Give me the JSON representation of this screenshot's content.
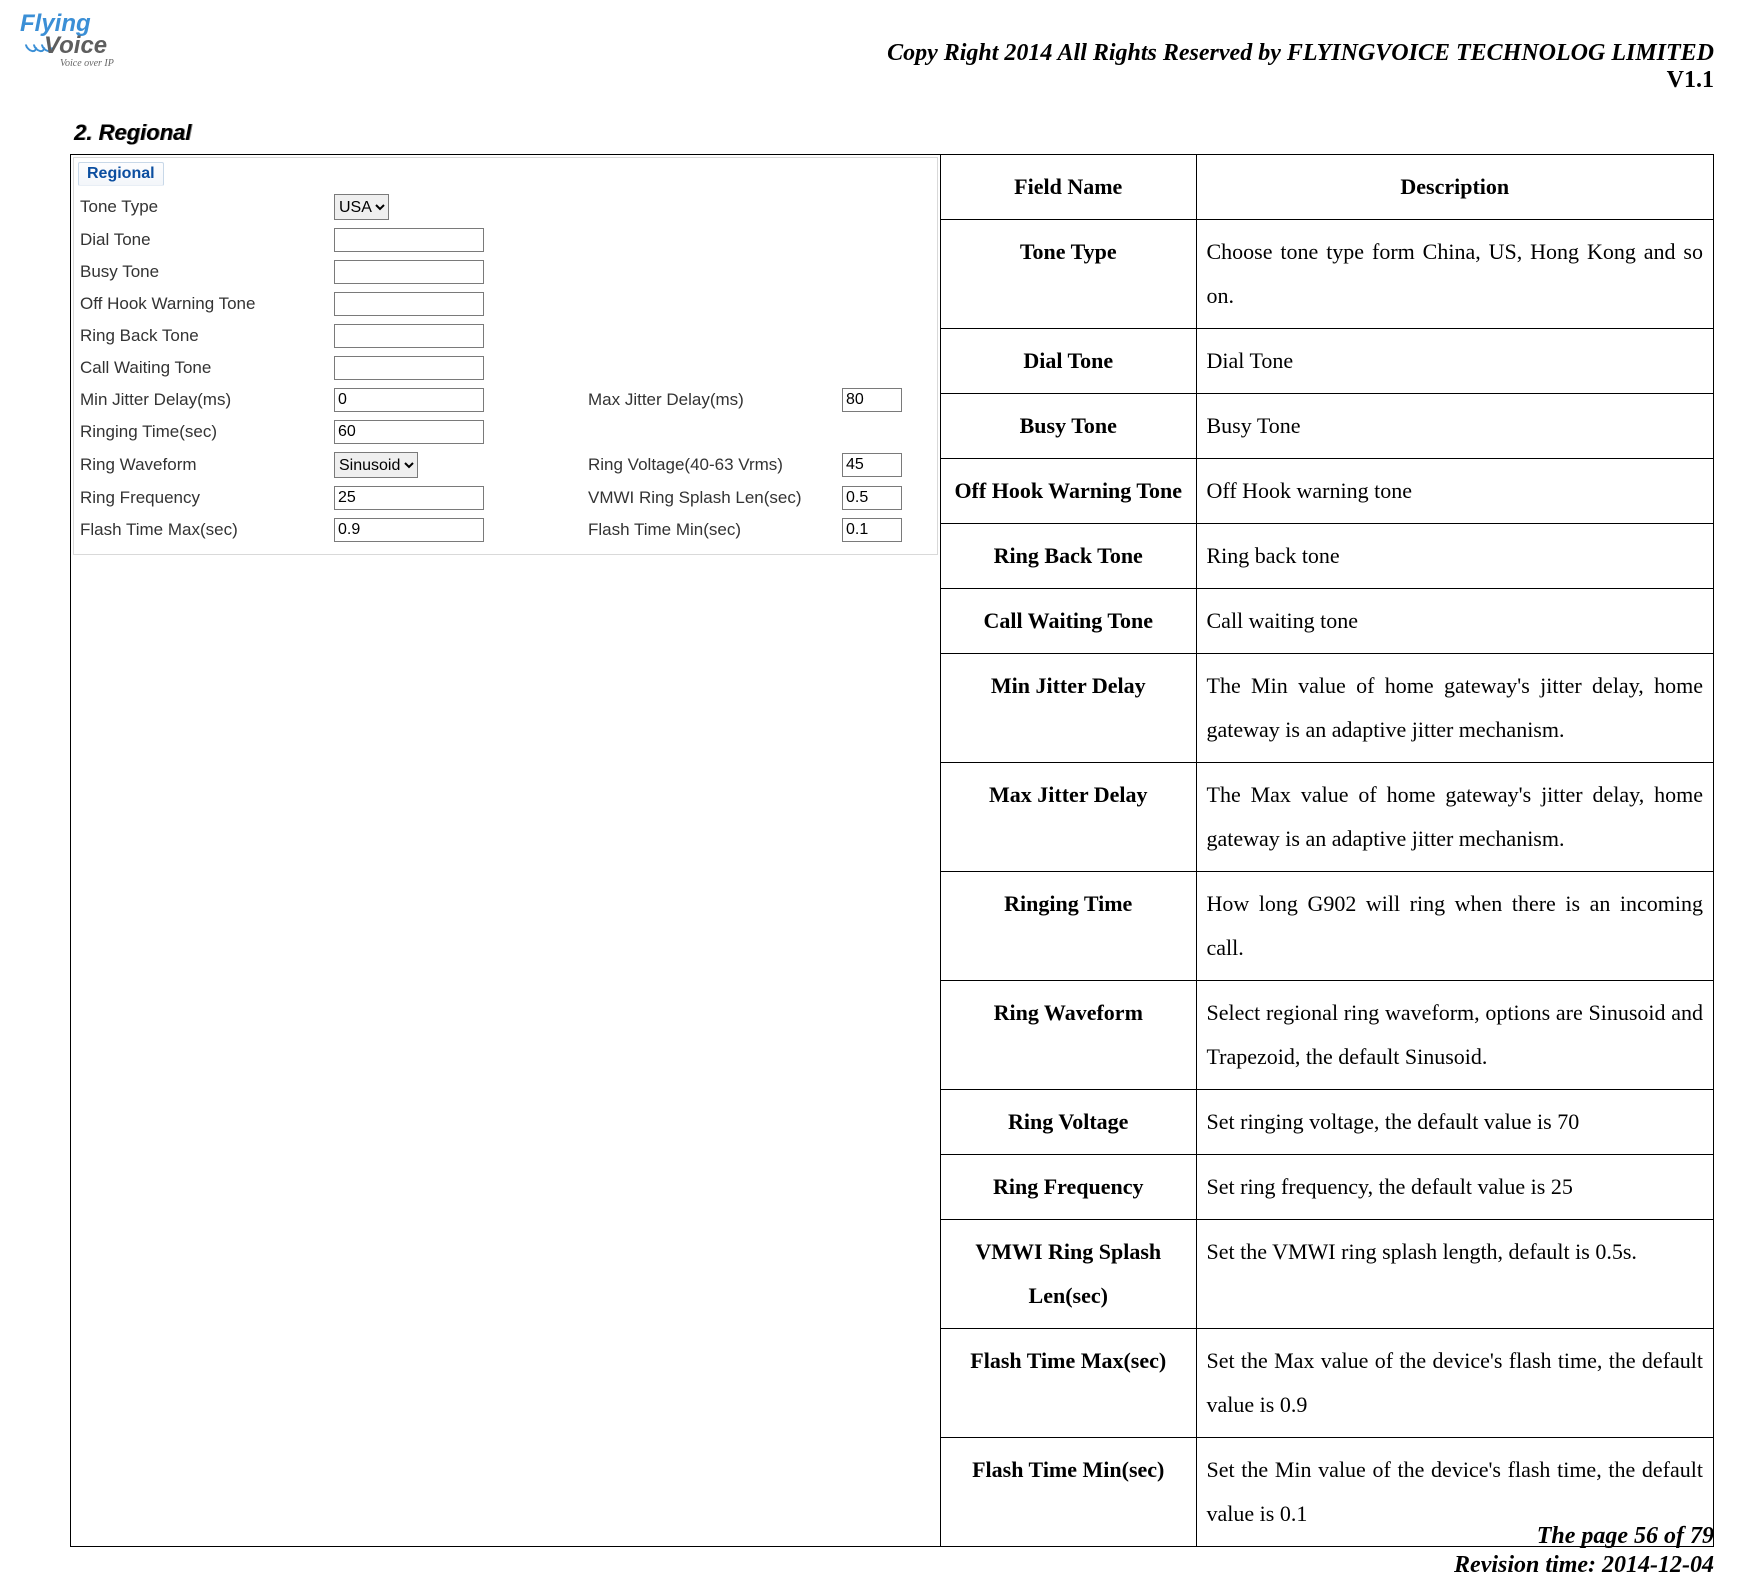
{
  "logo": {
    "line1": "Flying",
    "line2": "Voice",
    "sub": "Voice over IP"
  },
  "header": {
    "copyright": "Copy Right 2014 All Rights Reserved by FLYINGVOICE TECHNOLOG LIMITED",
    "version": "V1.1"
  },
  "section": {
    "number": "2.",
    "title": "Regional"
  },
  "form": {
    "legend": "Regional",
    "rows": [
      {
        "l1": "Tone Type",
        "v1_type": "select",
        "v1": "USA",
        "l2": "",
        "v2": ""
      },
      {
        "l1": "Dial Tone",
        "v1_type": "text",
        "v1": "",
        "l2": "",
        "v2": ""
      },
      {
        "l1": "Busy Tone",
        "v1_type": "text",
        "v1": "",
        "l2": "",
        "v2": ""
      },
      {
        "l1": "Off Hook Warning Tone",
        "v1_type": "text",
        "v1": "",
        "l2": "",
        "v2": ""
      },
      {
        "l1": "Ring Back Tone",
        "v1_type": "text",
        "v1": "",
        "l2": "",
        "v2": ""
      },
      {
        "l1": "Call Waiting Tone",
        "v1_type": "text",
        "v1": "",
        "l2": "",
        "v2": ""
      },
      {
        "l1": "Min Jitter Delay(ms)",
        "v1_type": "text",
        "v1": "0",
        "l2": "Max Jitter Delay(ms)",
        "v2": "80"
      },
      {
        "l1": "Ringing Time(sec)",
        "v1_type": "text",
        "v1": "60",
        "l2": "",
        "v2": ""
      },
      {
        "l1": "Ring Waveform",
        "v1_type": "select",
        "v1": "Sinusoid",
        "l2": "Ring Voltage(40-63 Vrms)",
        "v2": "45"
      },
      {
        "l1": "Ring Frequency",
        "v1_type": "text",
        "v1": "25",
        "l2": "VMWI Ring Splash Len(sec)",
        "v2": "0.5"
      },
      {
        "l1": "Flash Time Max(sec)",
        "v1_type": "text",
        "v1": "0.9",
        "l2": "Flash Time Min(sec)",
        "v2": "0.1"
      }
    ]
  },
  "table": {
    "head": {
      "c1": "Field Name",
      "c2": "Description"
    },
    "rows": [
      {
        "name": "Tone Type",
        "desc": "Choose tone type form China, US, Hong Kong and so on."
      },
      {
        "name": "Dial Tone",
        "desc": "Dial Tone"
      },
      {
        "name": "Busy Tone",
        "desc": "Busy Tone"
      },
      {
        "name": "Off Hook Warning Tone",
        "desc": "Off Hook warning tone"
      },
      {
        "name": "Ring Back Tone",
        "desc": "Ring back tone"
      },
      {
        "name": "Call Waiting Tone",
        "desc": "Call waiting tone"
      },
      {
        "name": "Min Jitter Delay",
        "desc": "The Min value of home gateway's jitter delay, home gateway is an adaptive jitter mechanism."
      },
      {
        "name": "Max Jitter Delay",
        "desc": "The Max value of home gateway's jitter delay, home gateway is an adaptive jitter mechanism."
      },
      {
        "name": "Ringing Time",
        "desc": "How long G902 will ring when there is an incoming call."
      },
      {
        "name": "Ring Waveform",
        "desc": "Select regional ring waveform, options are Sinusoid and Trapezoid, the default Sinusoid."
      },
      {
        "name": "Ring Voltage",
        "desc": "Set ringing voltage, the default value is 70"
      },
      {
        "name": "Ring Frequency",
        "desc": "Set ring frequency, the default value is 25"
      },
      {
        "name": "VMWI Ring Splash Len(sec)",
        "desc": "Set the VMWI ring splash length, default is 0.5s."
      },
      {
        "name": "Flash Time Max(sec)",
        "desc": "Set the Max value of the device's flash time, the default value is 0.9"
      },
      {
        "name": "Flash Time Min(sec)",
        "desc": "Set the Min value of the device's flash time, the default value is 0.1"
      }
    ]
  },
  "footer": {
    "page": "The page 56 of 79",
    "revision": "Revision time: 2014-12-04"
  }
}
